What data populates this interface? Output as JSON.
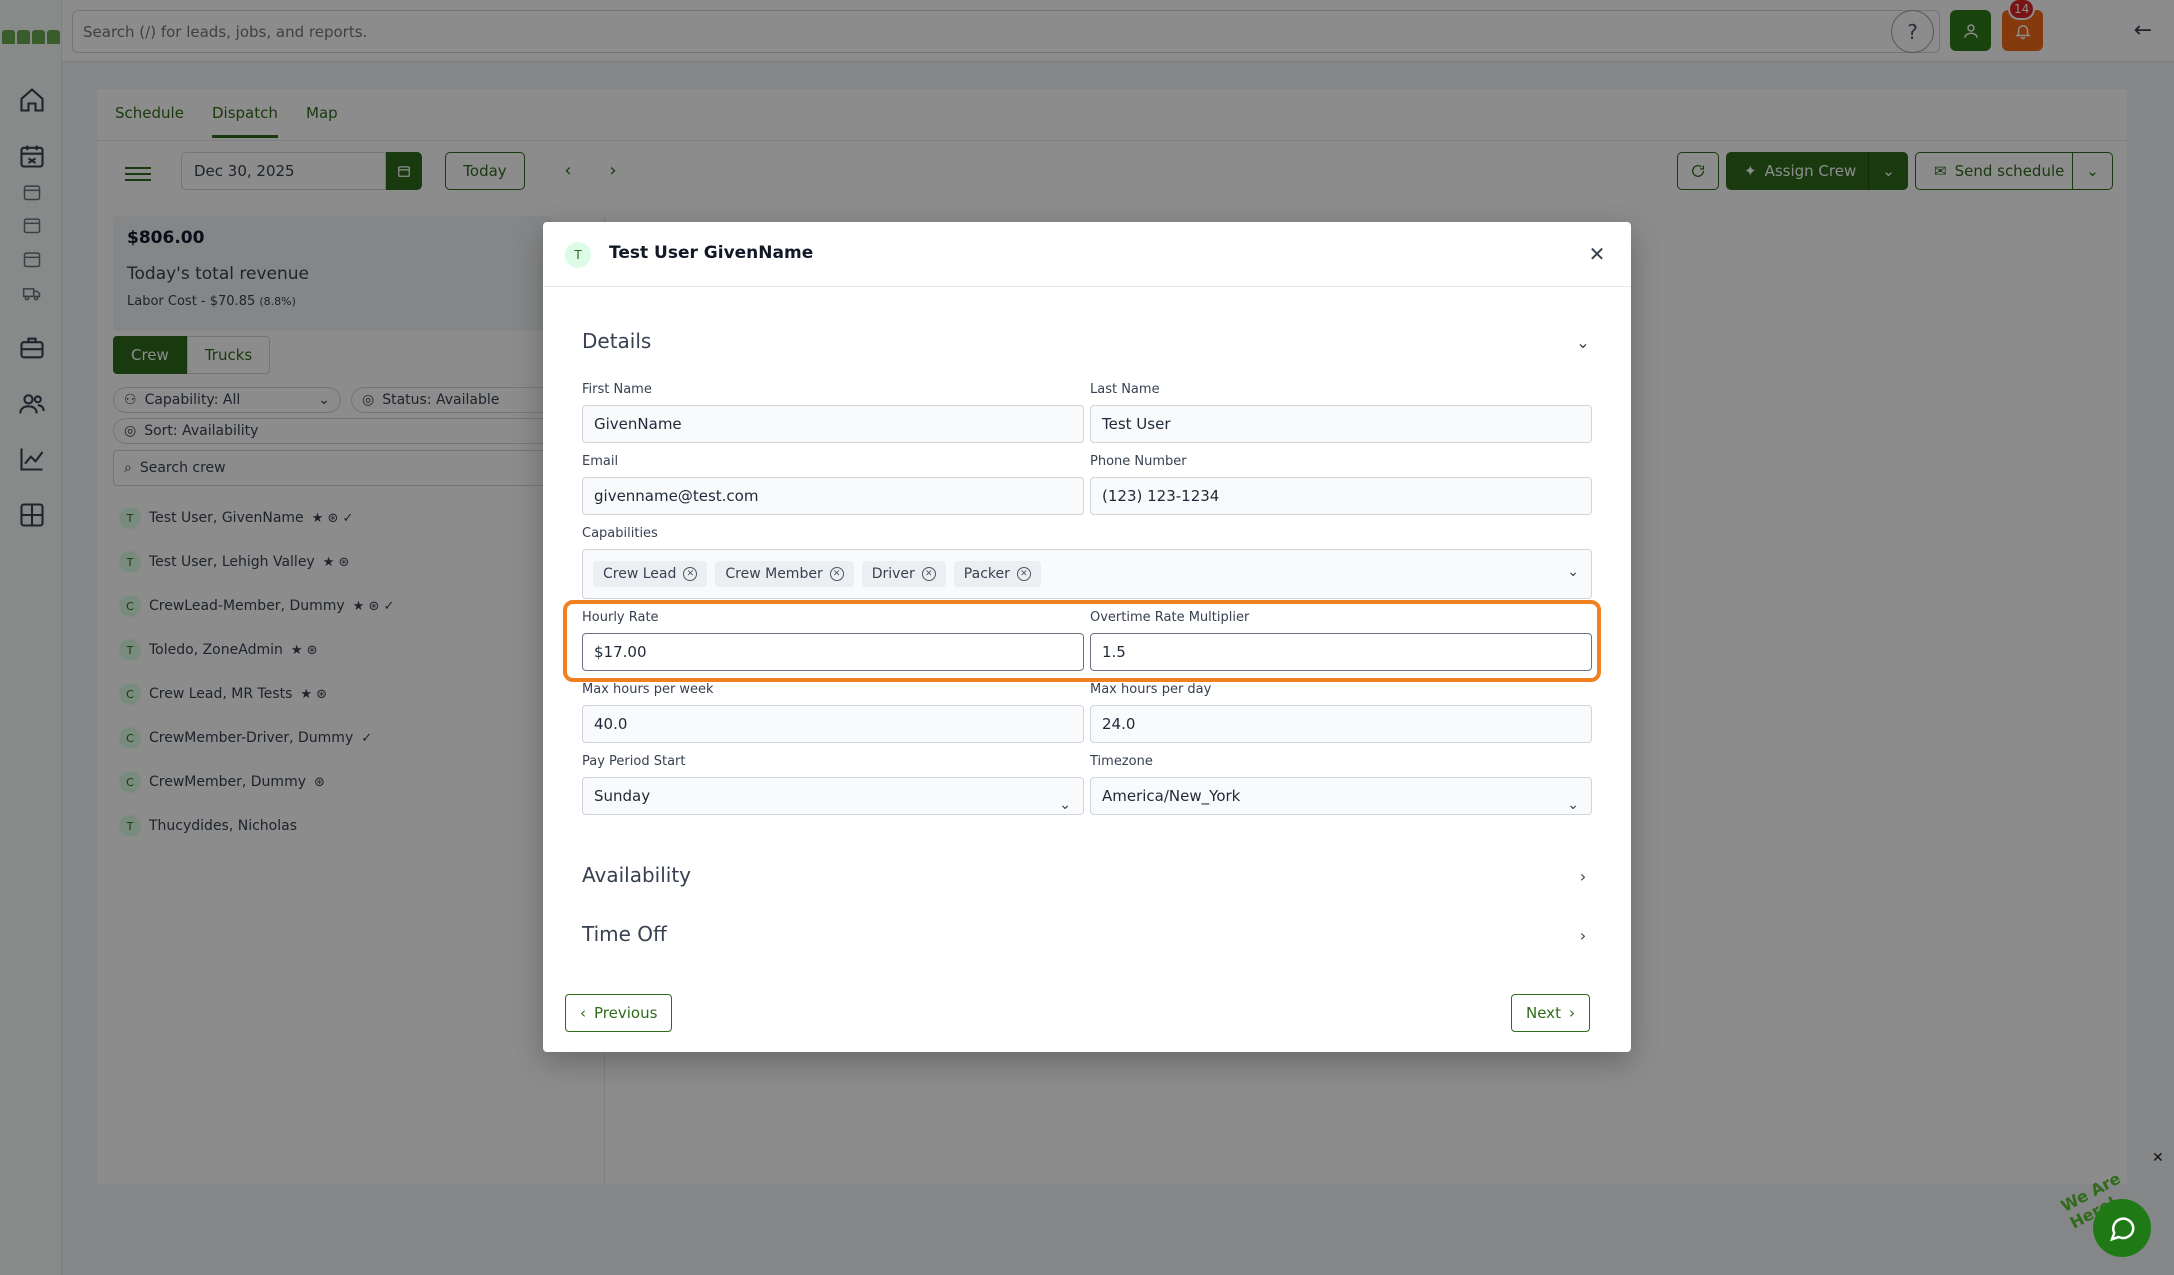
{
  "topbar": {
    "search_placeholder": "Search (/) for leads, jobs, and reports.",
    "help_label": "?",
    "notification_count": "14",
    "back_label": "←"
  },
  "tabs": [
    "Schedule",
    "Dispatch",
    "Map"
  ],
  "toolbar": {
    "date": "Dec 30, 2025",
    "today": "Today",
    "prev": "‹",
    "next": "›",
    "assign_crew": "Assign Crew",
    "send_schedule": "Send schedule"
  },
  "revenue": {
    "amount": "$806.00",
    "label": "Today's total revenue",
    "labor": "Labor Cost - $70.85",
    "labor_pct": "(8.8%)"
  },
  "segments": {
    "crew": "Crew",
    "trucks": "Trucks"
  },
  "filters": {
    "capability": "Capability: All",
    "status": "Status: Available",
    "sort": "Sort: Availability",
    "search_placeholder": "Search crew"
  },
  "crew": [
    {
      "initial": "T",
      "name": "Test User, GivenName",
      "badges": "★ ⊛ ✓"
    },
    {
      "initial": "T",
      "name": "Test User, Lehigh Valley",
      "badges": "★ ⊛"
    },
    {
      "initial": "C",
      "name": "CrewLead-Member, Dummy",
      "badges": "★ ⊛ ✓"
    },
    {
      "initial": "T",
      "name": "Toledo, ZoneAdmin",
      "badges": "★ ⊛"
    },
    {
      "initial": "C",
      "name": "Crew Lead, MR Tests",
      "badges": "★ ⊛"
    },
    {
      "initial": "C",
      "name": "CrewMember-Driver, Dummy",
      "badges": "✓"
    },
    {
      "initial": "C",
      "name": "CrewMember, Dummy",
      "badges": "⊛"
    },
    {
      "initial": "T",
      "name": "Thucydides, Nicholas",
      "badges": ""
    }
  ],
  "modal": {
    "avatar": "T",
    "title": "Test User GivenName",
    "details_title": "Details",
    "first_name_label": "First Name",
    "first_name": "GivenName",
    "last_name_label": "Last Name",
    "last_name": "Test User",
    "email_label": "Email",
    "email": "givenname@test.com",
    "phone_label": "Phone Number",
    "phone": "(123) 123-1234",
    "capabilities_label": "Capabilities",
    "capabilities": [
      "Crew Lead",
      "Crew Member",
      "Driver",
      "Packer"
    ],
    "hourly_rate_label": "Hourly Rate",
    "hourly_rate": "$17.00",
    "overtime_label": "Overtime Rate Multiplier",
    "overtime": "1.5",
    "max_week_label": "Max hours per week",
    "max_week": "40.0",
    "max_day_label": "Max hours per day",
    "max_day": "24.0",
    "pay_period_label": "Pay Period Start",
    "pay_period": "Sunday",
    "timezone_label": "Timezone",
    "timezone": "America/New_York",
    "availability_title": "Availability",
    "time_off_title": "Time Off",
    "previous": "Previous",
    "next": "Next"
  },
  "chat": {
    "tagline": "We Are Here!"
  },
  "colors": {
    "brand": "#2f6b1a",
    "accent": "#f26a1b",
    "highlight": "#f08020"
  }
}
